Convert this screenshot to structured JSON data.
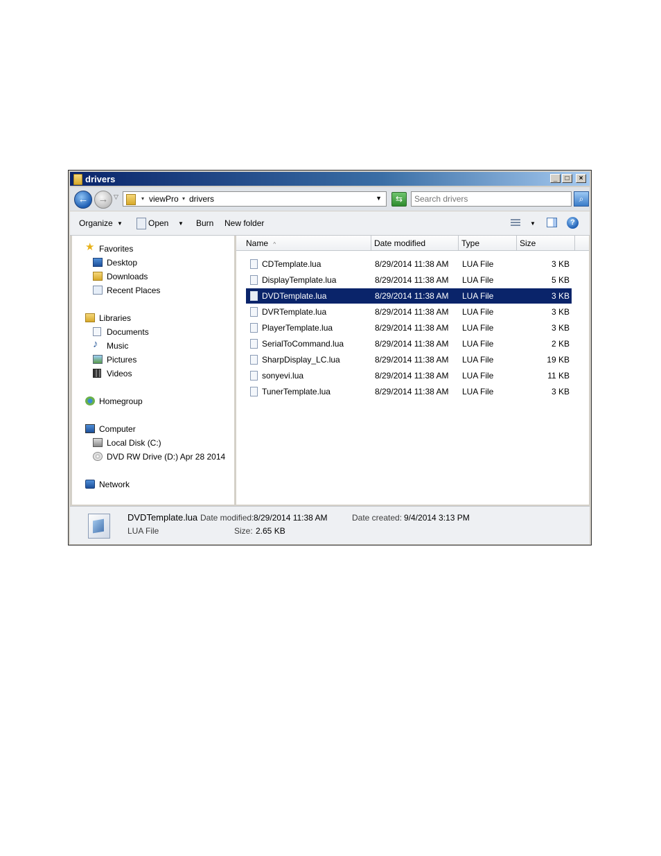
{
  "window": {
    "title": "drivers"
  },
  "address": {
    "crumbs": [
      "viewPro",
      "drivers"
    ],
    "search_placeholder": "Search drivers"
  },
  "toolbar": {
    "organize": "Organize",
    "open": "Open",
    "burn": "Burn",
    "new_folder": "New folder"
  },
  "nav": {
    "favorites": "Favorites",
    "desktop": "Desktop",
    "downloads": "Downloads",
    "recent_places": "Recent Places",
    "libraries": "Libraries",
    "documents": "Documents",
    "music": "Music",
    "pictures": "Pictures",
    "videos": "Videos",
    "homegroup": "Homegroup",
    "computer": "Computer",
    "local_disk": "Local Disk (C:)",
    "dvd_drive": "DVD RW Drive (D:) Apr 28 2014",
    "network": "Network"
  },
  "columns": {
    "name": "Name",
    "date": "Date modified",
    "type": "Type",
    "size": "Size"
  },
  "files": [
    {
      "name": "CDTemplate.lua",
      "date": "8/29/2014 11:38 AM",
      "type": "LUA File",
      "size": "3 KB"
    },
    {
      "name": "DisplayTemplate.lua",
      "date": "8/29/2014 11:38 AM",
      "type": "LUA File",
      "size": "5 KB"
    },
    {
      "name": "DVDTemplate.lua",
      "date": "8/29/2014 11:38 AM",
      "type": "LUA File",
      "size": "3 KB"
    },
    {
      "name": "DVRTemplate.lua",
      "date": "8/29/2014 11:38 AM",
      "type": "LUA File",
      "size": "3 KB"
    },
    {
      "name": "PlayerTemplate.lua",
      "date": "8/29/2014 11:38 AM",
      "type": "LUA File",
      "size": "3 KB"
    },
    {
      "name": "SerialToCommand.lua",
      "date": "8/29/2014 11:38 AM",
      "type": "LUA File",
      "size": "2 KB"
    },
    {
      "name": "SharpDisplay_LC.lua",
      "date": "8/29/2014 11:38 AM",
      "type": "LUA File",
      "size": "19 KB"
    },
    {
      "name": "sonyevi.lua",
      "date": "8/29/2014 11:38 AM",
      "type": "LUA File",
      "size": "11 KB"
    },
    {
      "name": "TunerTemplate.lua",
      "date": "8/29/2014 11:38 AM",
      "type": "LUA File",
      "size": "3 KB"
    }
  ],
  "details": {
    "filename": "DVDTemplate.lua",
    "filetype": "LUA File",
    "date_modified_label": "Date modified:",
    "date_modified": "8/29/2014 11:38 AM",
    "date_created_label": "Date created:",
    "date_created": "9/4/2014 3:13 PM",
    "size_label": "Size:",
    "size": "2.65 KB"
  },
  "colors": {
    "selection": "#0a246a",
    "titlebar": "#0a246a"
  }
}
